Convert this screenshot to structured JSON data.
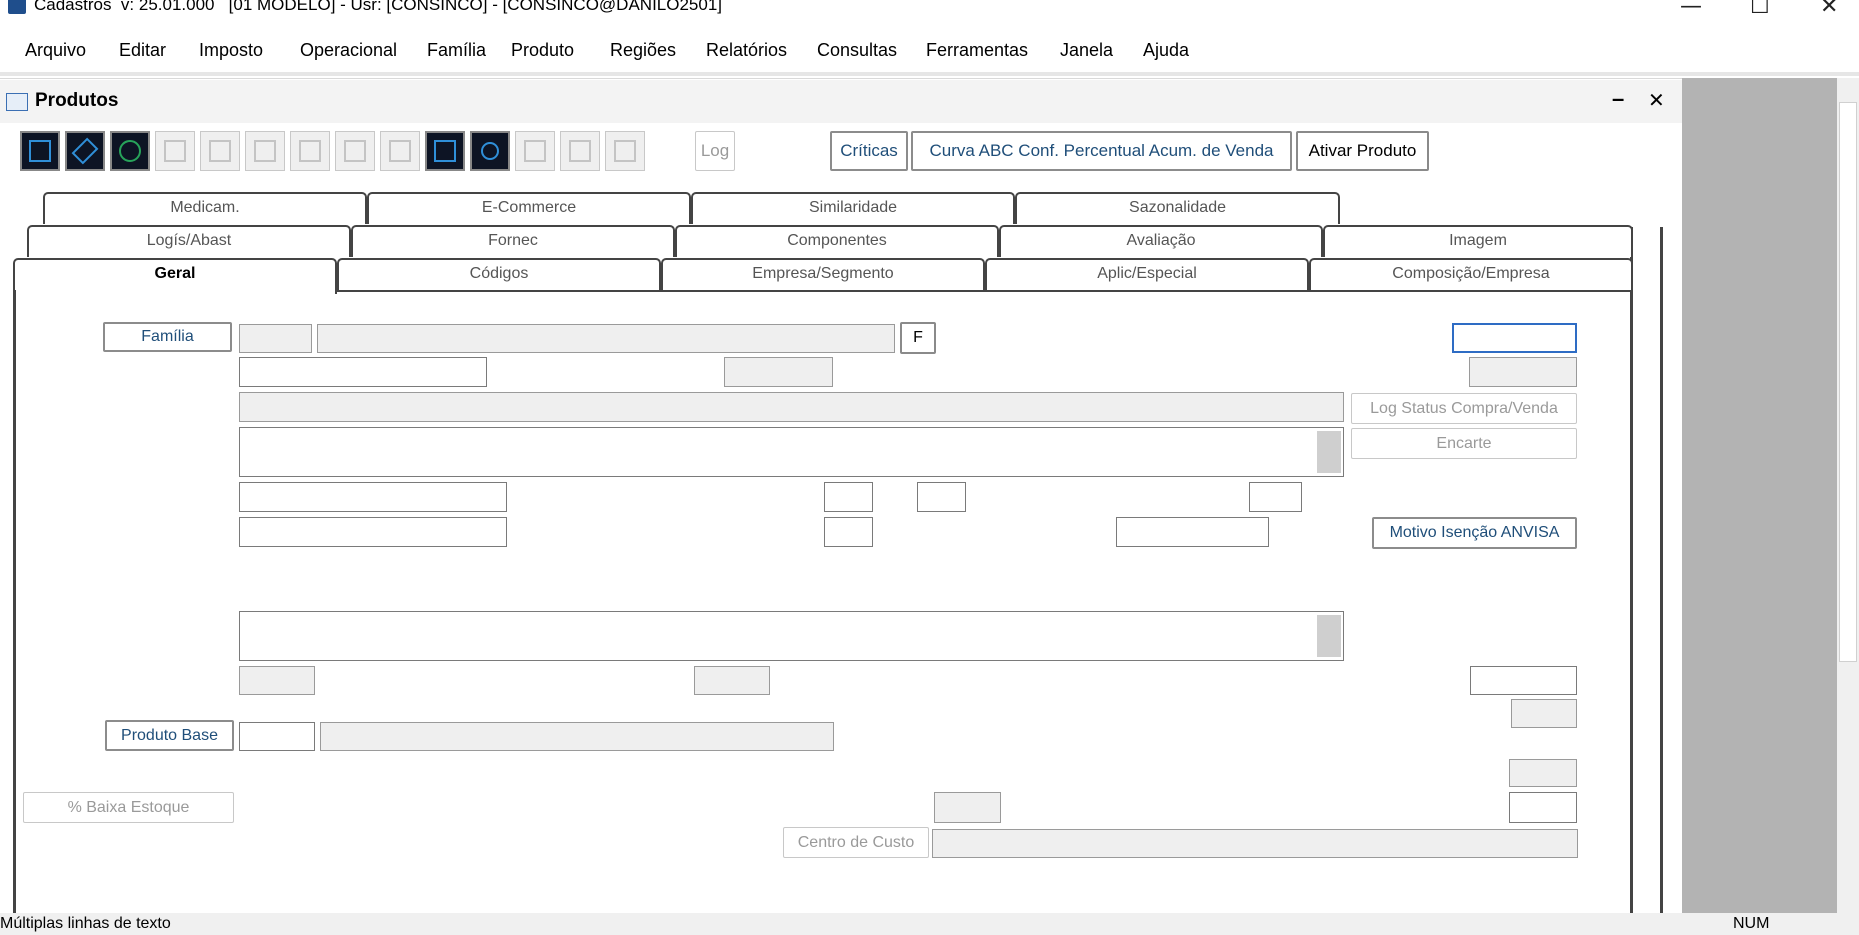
{
  "window": {
    "title": "Cadastros  v: 25.01.000   [01 MODELO] - Usr: [CONSINCO] - [CONSINCO@DANILO2501]",
    "minimize": "—",
    "maximize": "☐",
    "close": "✕"
  },
  "menu": [
    "Arquivo",
    "Editar",
    "Imposto",
    "Operacional",
    "Família",
    "Produto",
    "Regiões",
    "Relatórios",
    "Consultas",
    "Ferramentas",
    "Janela",
    "Ajuda"
  ],
  "child": {
    "title": "Produtos",
    "minimize": "–",
    "close": "✕"
  },
  "toolbar": {
    "log_label": "Log",
    "criticas_label": "Críticas",
    "curva_label": "Curva ABC Conf. Percentual Acum. de Venda",
    "ativar_label": "Ativar Produto"
  },
  "tabs_row1": [
    "Medicam.",
    "E-Commerce",
    "Similaridade",
    "Sazonalidade"
  ],
  "tabs_row2": [
    "Logís/Abast",
    "Fornec",
    "Componentes",
    "Avaliação",
    "Imagem"
  ],
  "tabs_row3": [
    "Geral",
    "Códigos",
    "Empresa/Segmento",
    "Aplic/Especial",
    "Composição/Empresa"
  ],
  "form": {
    "familia_button": "Família",
    "f_button": "F",
    "log_status_button": "Log Status Compra/Venda",
    "encarte_button": "Encarte",
    "motivo_button": "Motivo Isenção ANVISA",
    "produto_base_button": "Produto Base",
    "baixa_estoque_button": "% Baixa Estoque",
    "centro_custo_button": "Centro de Custo"
  },
  "status": {
    "text": "Múltiplas linhas de texto",
    "num": "NUM"
  },
  "colors": {
    "accent": "#1f4e79",
    "focus": "#2e6cc4",
    "toolbar_dark": "#0d1424"
  }
}
